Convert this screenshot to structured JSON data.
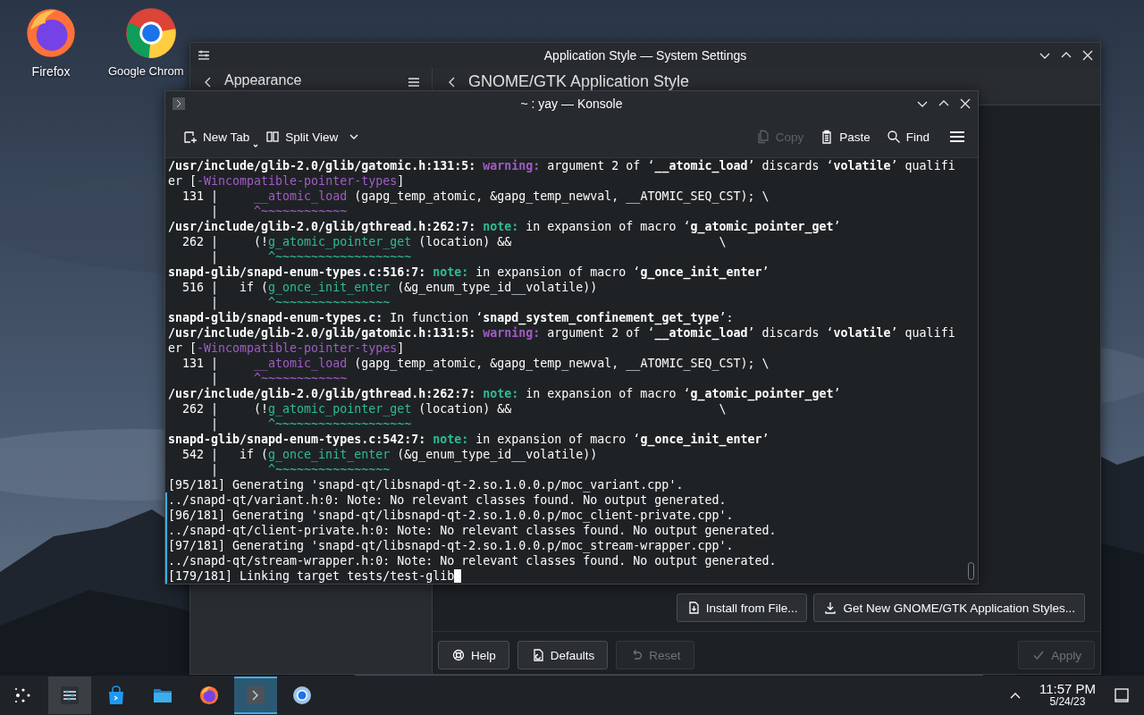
{
  "desktop_icons": [
    {
      "label": "Firefox",
      "kind": "firefox"
    },
    {
      "label": "Google Chrom",
      "kind": "chrome"
    }
  ],
  "settings_window": {
    "title": "Application Style — System Settings",
    "sidebar_title": "Appearance",
    "page_title": "GNOME/GTK Application Style",
    "actions": [
      {
        "label": "Install from File..."
      },
      {
        "label": "Get New GNOME/GTK Application Styles..."
      }
    ],
    "footer_buttons": [
      {
        "label": "Help",
        "disabled": false
      },
      {
        "label": "Defaults",
        "disabled": false
      },
      {
        "label": "Reset",
        "disabled": true
      },
      {
        "label": "Apply",
        "disabled": true
      }
    ]
  },
  "konsole": {
    "title": "~ : yay — Konsole",
    "toolbar": [
      {
        "label": "New Tab",
        "disabled": false
      },
      {
        "label": "Split View",
        "disabled": false
      },
      {
        "label": "Copy",
        "disabled": true
      },
      {
        "label": "Paste",
        "disabled": false
      },
      {
        "label": "Find",
        "disabled": false
      }
    ],
    "lines": [
      {
        "marked": false,
        "spans": [
          {
            "kind": "bold",
            "text": "/usr/include/glib-2.0/glib/gatomic.h:131:5:"
          },
          {
            "kind": "warning",
            "text": " warning:"
          },
          {
            "kind": "plain",
            "text": " argument 2 of ‘"
          },
          {
            "kind": "bold",
            "text": "__atomic_load"
          },
          {
            "kind": "plain",
            "text": "’ discards ‘"
          },
          {
            "kind": "bold",
            "text": "volatile"
          },
          {
            "kind": "plain",
            "text": "’ qualifi"
          }
        ]
      },
      {
        "marked": false,
        "spans": [
          {
            "kind": "plain",
            "text": "er ["
          },
          {
            "kind": "purple",
            "text": "-Wincompatible-pointer-types"
          },
          {
            "kind": "plain",
            "text": "]"
          }
        ]
      },
      {
        "marked": false,
        "spans": [
          {
            "kind": "plain",
            "text": "  131 |     "
          },
          {
            "kind": "purple",
            "text": "__atomic_load"
          },
          {
            "kind": "plain",
            "text": " (gapg_temp_atomic, &gapg_temp_newval, __ATOMIC_SEQ_CST); \\"
          }
        ]
      },
      {
        "marked": false,
        "spans": [
          {
            "kind": "plain",
            "text": "      |     "
          },
          {
            "kind": "purple",
            "text": "^~~~~~~~~~~~~"
          }
        ]
      },
      {
        "marked": false,
        "spans": [
          {
            "kind": "bold",
            "text": "/usr/include/glib-2.0/glib/gthread.h:262:7:"
          },
          {
            "kind": "note",
            "text": " note:"
          },
          {
            "kind": "plain",
            "text": " in expansion of macro ‘"
          },
          {
            "kind": "bold",
            "text": "g_atomic_pointer_get"
          },
          {
            "kind": "plain",
            "text": "’"
          }
        ]
      },
      {
        "marked": false,
        "spans": [
          {
            "kind": "plain",
            "text": "  262 |     (!"
          },
          {
            "kind": "green",
            "text": "g_atomic_pointer_get"
          },
          {
            "kind": "plain",
            "text": " (location) &&                             \\"
          }
        ]
      },
      {
        "marked": false,
        "spans": [
          {
            "kind": "plain",
            "text": "      |       "
          },
          {
            "kind": "green",
            "text": "^~~~~~~~~~~~~~~~~~~~"
          }
        ]
      },
      {
        "marked": false,
        "spans": [
          {
            "kind": "bold",
            "text": "snapd-glib/snapd-enum-types.c:516:7:"
          },
          {
            "kind": "note",
            "text": " note:"
          },
          {
            "kind": "plain",
            "text": " in expansion of macro ‘"
          },
          {
            "kind": "bold",
            "text": "g_once_init_enter"
          },
          {
            "kind": "plain",
            "text": "’"
          }
        ]
      },
      {
        "marked": false,
        "spans": [
          {
            "kind": "plain",
            "text": "  516 |   if ("
          },
          {
            "kind": "green",
            "text": "g_once_init_enter"
          },
          {
            "kind": "plain",
            "text": " (&g_enum_type_id__volatile))"
          }
        ]
      },
      {
        "marked": false,
        "spans": [
          {
            "kind": "plain",
            "text": "      |       "
          },
          {
            "kind": "green",
            "text": "^~~~~~~~~~~~~~~~~"
          }
        ]
      },
      {
        "marked": false,
        "spans": [
          {
            "kind": "bold",
            "text": "snapd-glib/snapd-enum-types.c:"
          },
          {
            "kind": "plain",
            "text": " In function ‘"
          },
          {
            "kind": "bold",
            "text": "snapd_system_confinement_get_type"
          },
          {
            "kind": "plain",
            "text": "’:"
          }
        ]
      },
      {
        "marked": false,
        "spans": [
          {
            "kind": "bold",
            "text": "/usr/include/glib-2.0/glib/gatomic.h:131:5:"
          },
          {
            "kind": "warning",
            "text": " warning:"
          },
          {
            "kind": "plain",
            "text": " argument 2 of ‘"
          },
          {
            "kind": "bold",
            "text": "__atomic_load"
          },
          {
            "kind": "plain",
            "text": "’ discards ‘"
          },
          {
            "kind": "bold",
            "text": "volatile"
          },
          {
            "kind": "plain",
            "text": "’ qualifi"
          }
        ]
      },
      {
        "marked": false,
        "spans": [
          {
            "kind": "plain",
            "text": "er ["
          },
          {
            "kind": "purple",
            "text": "-Wincompatible-pointer-types"
          },
          {
            "kind": "plain",
            "text": "]"
          }
        ]
      },
      {
        "marked": false,
        "spans": [
          {
            "kind": "plain",
            "text": "  131 |     "
          },
          {
            "kind": "purple",
            "text": "__atomic_load"
          },
          {
            "kind": "plain",
            "text": " (gapg_temp_atomic, &gapg_temp_newval, __ATOMIC_SEQ_CST); \\"
          }
        ]
      },
      {
        "marked": false,
        "spans": [
          {
            "kind": "plain",
            "text": "      |     "
          },
          {
            "kind": "purple",
            "text": "^~~~~~~~~~~~~"
          }
        ]
      },
      {
        "marked": false,
        "spans": [
          {
            "kind": "bold",
            "text": "/usr/include/glib-2.0/glib/gthread.h:262:7:"
          },
          {
            "kind": "note",
            "text": " note:"
          },
          {
            "kind": "plain",
            "text": " in expansion of macro ‘"
          },
          {
            "kind": "bold",
            "text": "g_atomic_pointer_get"
          },
          {
            "kind": "plain",
            "text": "’"
          }
        ]
      },
      {
        "marked": false,
        "spans": [
          {
            "kind": "plain",
            "text": "  262 |     (!"
          },
          {
            "kind": "green",
            "text": "g_atomic_pointer_get"
          },
          {
            "kind": "plain",
            "text": " (location) &&                             \\"
          }
        ]
      },
      {
        "marked": false,
        "spans": [
          {
            "kind": "plain",
            "text": "      |       "
          },
          {
            "kind": "green",
            "text": "^~~~~~~~~~~~~~~~~~~~"
          }
        ]
      },
      {
        "marked": false,
        "spans": [
          {
            "kind": "bold",
            "text": "snapd-glib/snapd-enum-types.c:542:7:"
          },
          {
            "kind": "note",
            "text": " note:"
          },
          {
            "kind": "plain",
            "text": " in expansion of macro ‘"
          },
          {
            "kind": "bold",
            "text": "g_once_init_enter"
          },
          {
            "kind": "plain",
            "text": "’"
          }
        ]
      },
      {
        "marked": false,
        "spans": [
          {
            "kind": "plain",
            "text": "  542 |   if ("
          },
          {
            "kind": "green",
            "text": "g_once_init_enter"
          },
          {
            "kind": "plain",
            "text": " (&g_enum_type_id__volatile))"
          }
        ]
      },
      {
        "marked": false,
        "spans": [
          {
            "kind": "plain",
            "text": "      |       "
          },
          {
            "kind": "green",
            "text": "^~~~~~~~~~~~~~~~~"
          }
        ]
      },
      {
        "marked": false,
        "spans": [
          {
            "kind": "plain",
            "text": "[95/181] Generating 'snapd-qt/libsnapd-qt-2.so.1.0.0.p/moc_variant.cpp'."
          }
        ]
      },
      {
        "marked": true,
        "spans": [
          {
            "kind": "plain",
            "text": "../snapd-qt/variant.h:0: Note: No relevant classes found. No output generated."
          }
        ]
      },
      {
        "marked": true,
        "spans": [
          {
            "kind": "plain",
            "text": "[96/181] Generating 'snapd-qt/libsnapd-qt-2.so.1.0.0.p/moc_client-private.cpp'."
          }
        ]
      },
      {
        "marked": true,
        "spans": [
          {
            "kind": "plain",
            "text": "../snapd-qt/client-private.h:0: Note: No relevant classes found. No output generated."
          }
        ]
      },
      {
        "marked": true,
        "spans": [
          {
            "kind": "plain",
            "text": "[97/181] Generating 'snapd-qt/libsnapd-qt-2.so.1.0.0.p/moc_stream-wrapper.cpp'."
          }
        ]
      },
      {
        "marked": true,
        "spans": [
          {
            "kind": "plain",
            "text": "../snapd-qt/stream-wrapper.h:0: Note: No relevant classes found. No output generated."
          }
        ]
      },
      {
        "marked": true,
        "spans": [
          {
            "kind": "plain",
            "text": "[179/181] Linking target tests/test-glib"
          }
        ]
      }
    ]
  },
  "taskbar": {
    "items": [
      {
        "kind": "launcher",
        "open": false,
        "selected": false
      },
      {
        "kind": "settings",
        "open": true,
        "selected": false
      },
      {
        "kind": "store",
        "open": false,
        "selected": false
      },
      {
        "kind": "files",
        "open": false,
        "selected": false
      },
      {
        "kind": "firefox",
        "open": false,
        "selected": false
      },
      {
        "kind": "konsole",
        "open": true,
        "selected": true
      },
      {
        "kind": "chrome",
        "open": false,
        "selected": false
      }
    ],
    "time": "11:57 PM",
    "date": "5/24/23"
  }
}
